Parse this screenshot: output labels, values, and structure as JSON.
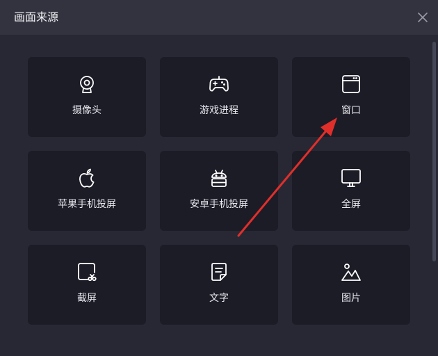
{
  "dialog": {
    "title": "画面来源",
    "close_icon": "close-icon"
  },
  "colors": {
    "background": "#272834",
    "titlebar": "#32333f",
    "card": "#1c1c27",
    "text": "#e8e8ee",
    "annotation_arrow": "#e02f2a"
  },
  "sources": [
    {
      "label": "摄像头",
      "icon": "camera-icon"
    },
    {
      "label": "游戏进程",
      "icon": "gamepad-icon"
    },
    {
      "label": "窗口",
      "icon": "window-icon"
    },
    {
      "label": "苹果手机投屏",
      "icon": "apple-icon"
    },
    {
      "label": "安卓手机投屏",
      "icon": "android-icon"
    },
    {
      "label": "全屏",
      "icon": "monitor-icon"
    },
    {
      "label": "截屏",
      "icon": "screenshot-icon"
    },
    {
      "label": "文字",
      "icon": "text-document-icon"
    },
    {
      "label": "图片",
      "icon": "image-icon"
    }
  ]
}
